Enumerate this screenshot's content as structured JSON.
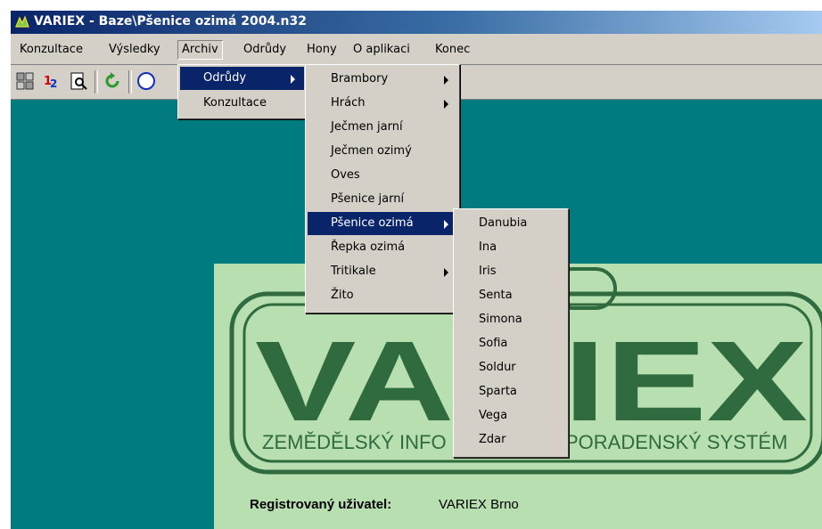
{
  "window": {
    "title": "VARIEX - Baze\\Pšenice ozimá 2004.n32"
  },
  "menubar": [
    "Konzultace",
    "Výsledky",
    "Archiv",
    "Odrůdy",
    "Hony",
    "O aplikaci",
    "Konec"
  ],
  "toolbar": [
    "puzzle-icon",
    "numbers-icon",
    "preview-icon",
    "refresh-icon",
    "help-icon"
  ],
  "archiv_menu": [
    "Odrůdy",
    "Konzultace"
  ],
  "odrudy_menu": [
    "Brambory",
    "Hrách",
    "Ječmen jarní",
    "Ječmen ozimý",
    "Oves",
    "Pšenice jarní",
    "Pšenice ozimá",
    "Řepka ozimá",
    "Tritikale",
    "Žito"
  ],
  "psenice_menu": [
    "Danubia",
    "Ina",
    "Iris",
    "Senta",
    "Simona",
    "Sofia",
    "Soldur",
    "Sparta",
    "Vega",
    "Zdar"
  ],
  "splash": {
    "logo": "VARIEX",
    "subtitle_left": "ZEMĚDĚLSKÝ INFO",
    "subtitle_right": "PORADENSKÝ SYSTÉM",
    "reg_label": "Registrovaný uživatel:",
    "reg_value": "VARIEX Brno"
  },
  "colors": {
    "workspace": "#007c80",
    "splash_bg": "#b7dfb0",
    "logo_green": "#2f6b3e",
    "menu_highlight": "#0a246a"
  }
}
